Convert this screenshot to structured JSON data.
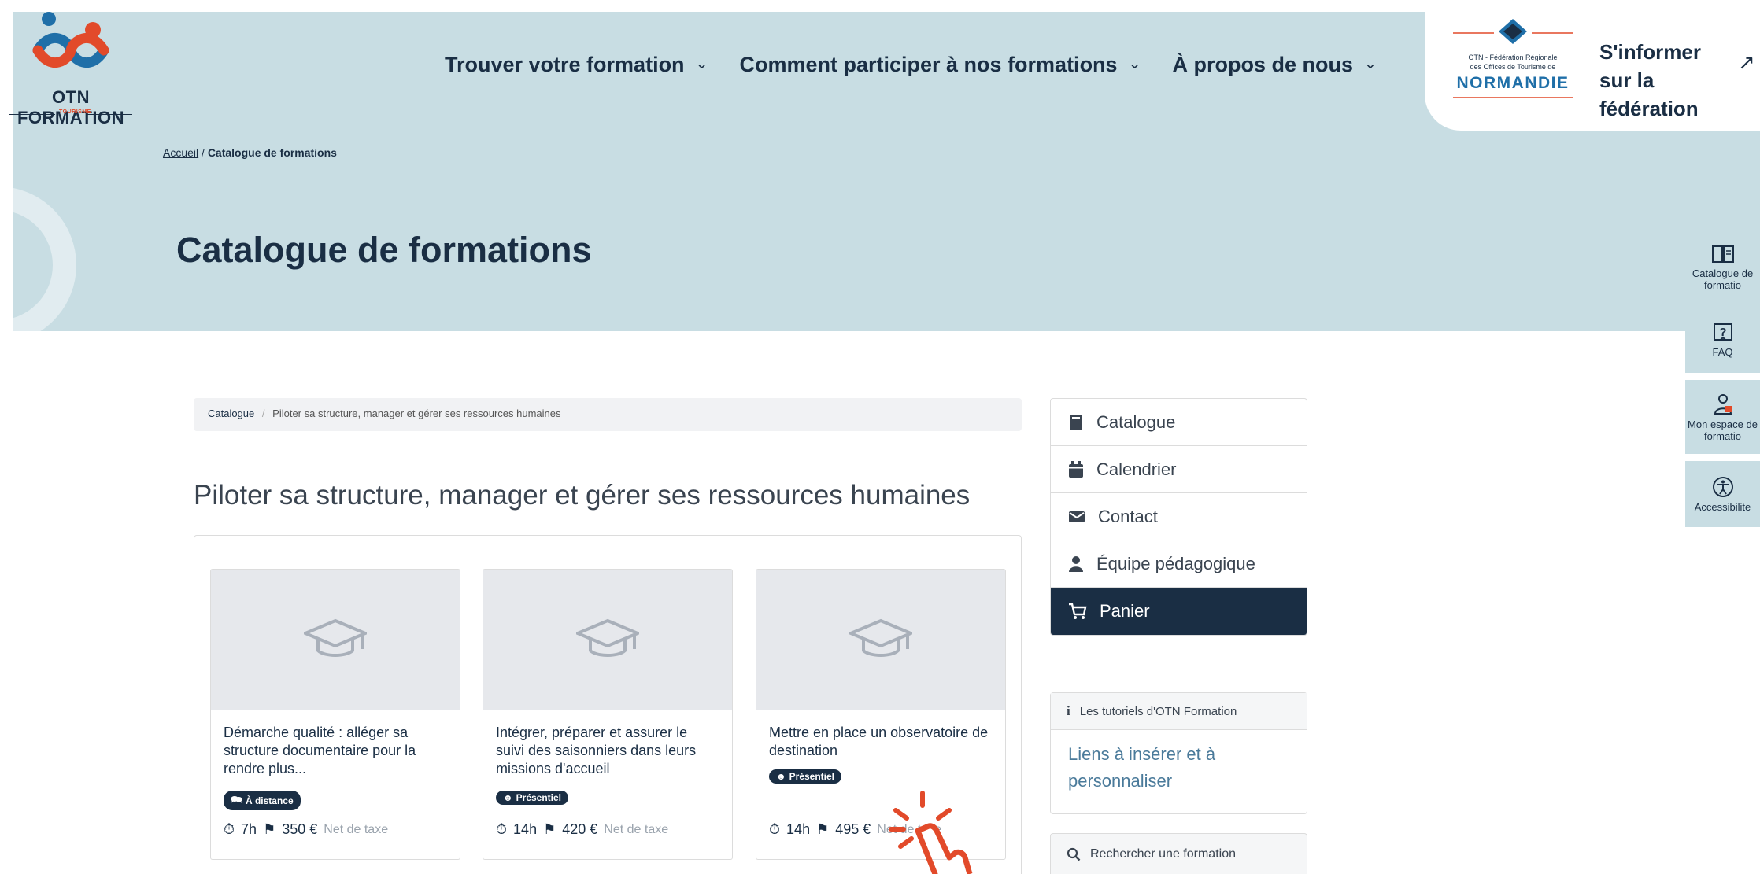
{
  "logo": {
    "text": "OTN FORMATION",
    "sub": "TOURISME"
  },
  "nav": {
    "items": [
      {
        "label": "Trouver votre formation"
      },
      {
        "label": "Comment participer à nos formations"
      },
      {
        "label": "À propos de nous"
      }
    ]
  },
  "federation": {
    "logo_top": "OTN - Fédération Régionale",
    "logo_mid": "des Offices de Tourisme de",
    "logo_big": "NORMANDIE",
    "link_text": "S'informer sur la fédération"
  },
  "breadcrumb": {
    "home": "Accueil",
    "separator": "/",
    "current": "Catalogue de formations"
  },
  "page_title": "Catalogue de formations",
  "side_tools": [
    {
      "label": "Catalogue de formatio",
      "icon": "book-icon"
    },
    {
      "label": "FAQ",
      "icon": "question-icon"
    },
    {
      "label": "Mon espace de formatio",
      "icon": "user-icon"
    },
    {
      "label": "Accessibilite",
      "icon": "accessibility-icon"
    }
  ],
  "catalog_crumb": {
    "root": "Catalogue",
    "separator": "/",
    "current": "Piloter sa structure, manager et gérer ses ressources humaines"
  },
  "section_title": "Piloter sa structure, manager et gérer ses ressources humaines",
  "cards": [
    {
      "title": "Démarche qualité : alléger sa structure documentaire pour la rendre plus...",
      "badge": "À distance",
      "duration": "7h",
      "price": "350 €",
      "price_note": "Net de taxe"
    },
    {
      "title": "Intégrer, préparer et assurer le suivi des saisonniers dans leurs missions d'accueil",
      "badge": "Présentiel",
      "duration": "14h",
      "price": "420 €",
      "price_note": "Net de taxe"
    },
    {
      "title": "Mettre en place un observatoire de destination",
      "badge": "Présentiel",
      "duration": "14h",
      "price": "495 €",
      "price_note": "Net de taxe"
    }
  ],
  "side_menu": [
    {
      "label": "Catalogue",
      "icon": "book-icon"
    },
    {
      "label": "Calendrier",
      "icon": "calendar-icon"
    },
    {
      "label": "Contact",
      "icon": "envelope-icon"
    },
    {
      "label": "Équipe pédagogique",
      "icon": "user-icon"
    },
    {
      "label": "Panier",
      "icon": "cart-icon"
    }
  ],
  "tutorials": {
    "title": "Les tutoriels d'OTN Formation",
    "link": "Liens à insérer et à personnaliser"
  },
  "search": {
    "label": "Rechercher une formation"
  },
  "colors": {
    "navy": "#1a2e44",
    "band": "#c8dde3",
    "orange": "#e24a2a",
    "blue_logo": "#1f6fa8"
  }
}
